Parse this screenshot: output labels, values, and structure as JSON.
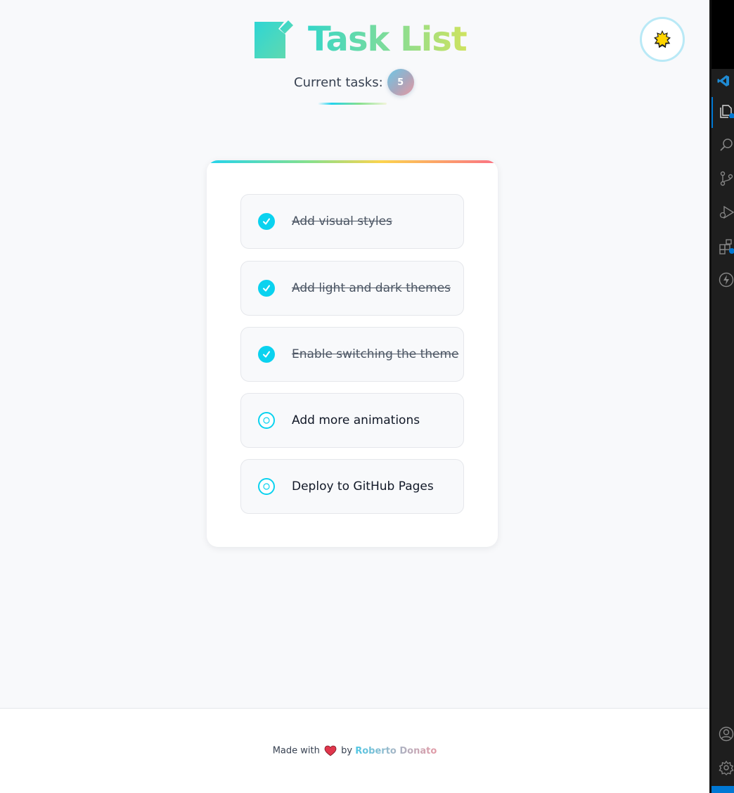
{
  "header": {
    "title": "Task List",
    "counter_label": "Current tasks:",
    "counter_value": "5"
  },
  "theme_toggle": {
    "icon": "sun-icon",
    "state": "light"
  },
  "tasks": [
    {
      "text": "Add visual styles",
      "completed": true
    },
    {
      "text": "Add light and dark themes",
      "completed": true
    },
    {
      "text": "Enable switching the theme",
      "completed": true
    },
    {
      "text": "Add more animations",
      "completed": false
    },
    {
      "text": "Deploy to GitHub Pages",
      "completed": false
    }
  ],
  "footer": {
    "made_with": "Made with",
    "by": "by",
    "author": "Roberto Donato",
    "heart_icon": "heart-icon"
  },
  "colors": {
    "accent_cyan": "#0ad2ef",
    "title_gradient_start": "#35d6c8",
    "title_gradient_end": "#cfe35f",
    "card_accent_end": "#fb7185"
  },
  "vscode_activity_bar": {
    "icons": [
      "vscode-logo-icon",
      "explorer-icon",
      "search-icon",
      "source-control-icon",
      "run-debug-icon",
      "extensions-icon",
      "lightning-icon",
      "account-icon",
      "settings-gear-icon"
    ]
  }
}
